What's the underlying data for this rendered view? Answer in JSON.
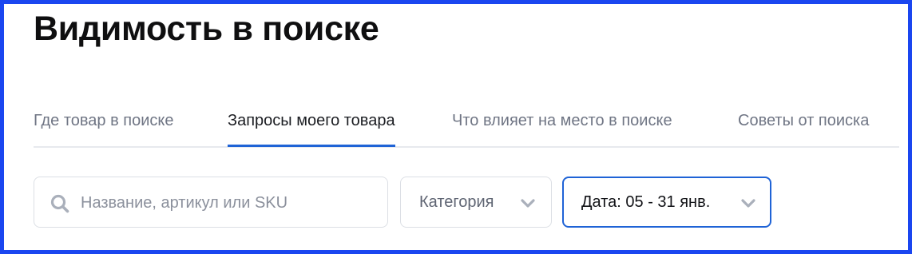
{
  "header": {
    "title": "Видимость в поиске"
  },
  "tabs": [
    {
      "label": "Где товар в поиске",
      "active": false
    },
    {
      "label": "Запросы моего товара",
      "active": true
    },
    {
      "label": "Что влияет на место в поиске",
      "active": false
    },
    {
      "label": "Советы от поиска",
      "active": false
    }
  ],
  "filters": {
    "search": {
      "placeholder": "Название, артикул или SKU",
      "value": "",
      "icon": "search-icon"
    },
    "category": {
      "label": "Категория",
      "icon": "chevron-down-icon"
    },
    "date": {
      "label": "Дата: 05 - 31 янв.",
      "icon": "chevron-down-icon"
    }
  },
  "colors": {
    "accent": "#1f63d6",
    "frame": "#1a46f0",
    "text_primary": "#0f0f10",
    "text_secondary": "#6f7584",
    "border": "#dcdfe5"
  }
}
